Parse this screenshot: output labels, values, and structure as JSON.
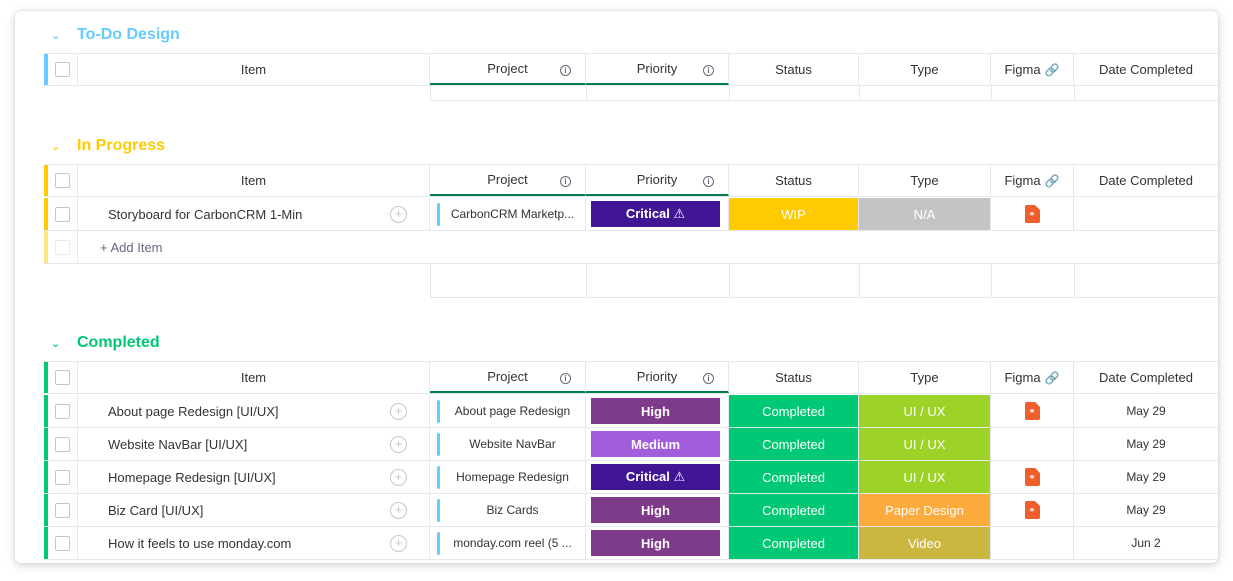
{
  "columns": {
    "item": "Item",
    "project": "Project",
    "priority": "Priority",
    "status": "Status",
    "type": "Type",
    "figma": "Figma",
    "date": "Date Completed"
  },
  "colors": {
    "todo": "#66ccff",
    "in_progress": "#ffcb00",
    "completed": "#00c875",
    "critical": "#401694",
    "high": "#7e3b8a",
    "medium": "#a25ddc",
    "wip": "#ffcb00",
    "na": "#c4c4c4",
    "ui_ux": "#9cd326",
    "paper_design": "#fdab3d",
    "video": "#cab641",
    "figma": "#f05e2b"
  },
  "groups": {
    "todo": {
      "title": "To-Do Design"
    },
    "in_progress": {
      "title": "In Progress",
      "rows": [
        {
          "item": "Storyboard for CarbonCRM 1-Min",
          "project": "CarbonCRM Marketp...",
          "priority": "Critical ⚠",
          "status": "WIP",
          "type": "N/A",
          "figma": "figma-file-icon",
          "date": ""
        }
      ],
      "add_item": "+ Add Item"
    },
    "completed": {
      "title": "Completed",
      "rows": [
        {
          "item": "About page Redesign [UI/UX]",
          "project": "About page Redesign",
          "priority": "High",
          "status": "Completed",
          "type": "UI / UX",
          "figma": "figma-file-icon",
          "date": "May 29"
        },
        {
          "item": "Website NavBar [UI/UX]",
          "project": "Website NavBar",
          "priority": "Medium",
          "status": "Completed",
          "type": "UI / UX",
          "figma": "",
          "date": "May 29"
        },
        {
          "item": "Homepage Redesign [UI/UX]",
          "project": "Homepage Redesign",
          "priority": "Critical ⚠",
          "status": "Completed",
          "type": "UI / UX",
          "figma": "figma-file-icon",
          "date": "May 29"
        },
        {
          "item": "Biz Card [UI/UX]",
          "project": "Biz Cards",
          "priority": "High",
          "status": "Completed",
          "type": "Paper Design",
          "figma": "figma-file-icon",
          "date": "May 29"
        },
        {
          "item": "How it feels to use monday.com",
          "project": "monday.com reel (5 ...",
          "priority": "High",
          "status": "Completed",
          "type": "Video",
          "figma": "",
          "date": "Jun 2"
        }
      ]
    }
  }
}
